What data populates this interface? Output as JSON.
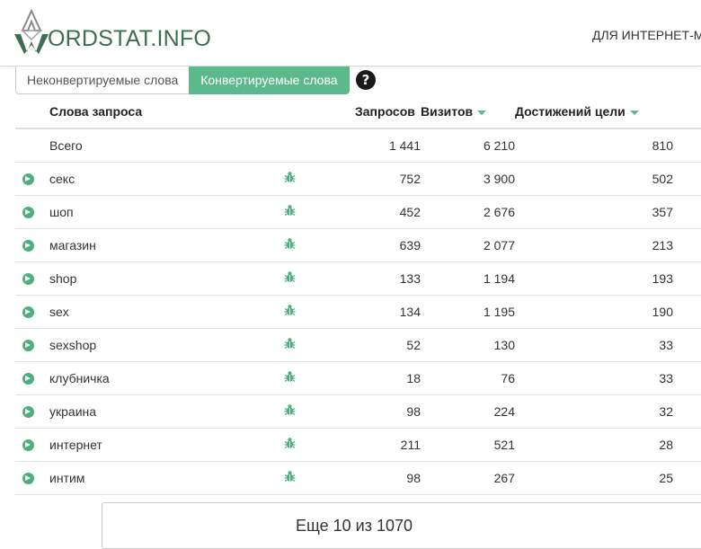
{
  "header": {
    "logo_text": "ORDSTAT.INFO",
    "nav_text": "ДЛЯ ИНТЕРНЕТ-М"
  },
  "tabs": [
    {
      "label": "Неконвертируемые слова",
      "active": false
    },
    {
      "label": "Конвертируемые слова",
      "active": true
    }
  ],
  "help_icon": "?",
  "table": {
    "headers": {
      "word": "Слова запроса",
      "requests": "Запросов",
      "visits": "Визитов",
      "goals": "Достижений цели"
    },
    "total": {
      "label": "Всего",
      "requests": "1 441",
      "visits": "6 210",
      "goals": "810"
    },
    "rows": [
      {
        "word": "секс",
        "requests": "752",
        "visits": "3 900",
        "goals": "502"
      },
      {
        "word": "шоп",
        "requests": "452",
        "visits": "2 676",
        "goals": "357"
      },
      {
        "word": "магазин",
        "requests": "639",
        "visits": "2 077",
        "goals": "213"
      },
      {
        "word": "shop",
        "requests": "133",
        "visits": "1 194",
        "goals": "193"
      },
      {
        "word": "sex",
        "requests": "134",
        "visits": "1 195",
        "goals": "190"
      },
      {
        "word": "sexshop",
        "requests": "52",
        "visits": "130",
        "goals": "33"
      },
      {
        "word": "клубничка",
        "requests": "18",
        "visits": "76",
        "goals": "33"
      },
      {
        "word": "украина",
        "requests": "98",
        "visits": "224",
        "goals": "32"
      },
      {
        "word": "интернет",
        "requests": "211",
        "visits": "521",
        "goals": "28"
      },
      {
        "word": "интим",
        "requests": "98",
        "visits": "267",
        "goals": "25"
      }
    ]
  },
  "more_button": "Еще 10 из 1070",
  "colors": {
    "accent": "#5bb98c",
    "logo": "#3c6e52"
  },
  "icons": {
    "row_arrow": "arrow-circle-right-icon",
    "row_bug": "bug-icon",
    "help": "question-circle-icon"
  }
}
